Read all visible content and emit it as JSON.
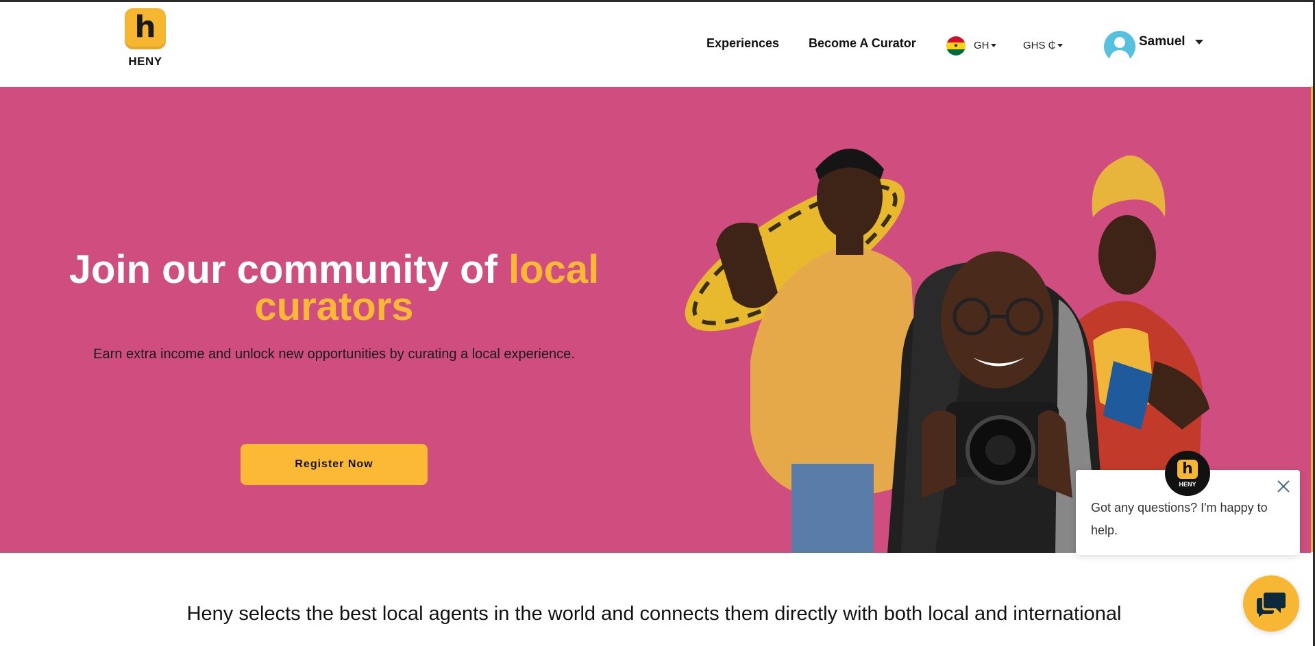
{
  "brand": {
    "name": "HENY",
    "mark": "h"
  },
  "nav": {
    "experiences": "Experiences",
    "become_curator": "Become A Curator"
  },
  "locale": {
    "country_code": "GH",
    "currency": "GHS ₵"
  },
  "user": {
    "name": "Samuel"
  },
  "hero": {
    "title_part1": "Join our community of ",
    "title_highlight1": "local",
    "title_highlight2": "curators",
    "subtitle": "Earn extra income and unlock new opportunities by curating a local experience.",
    "cta": "Register Now"
  },
  "chat": {
    "brand": "HENY",
    "mark": "h",
    "message": "Got any questions? I'm happy to help."
  },
  "footer_intro": {
    "text": "Heny selects the best local agents in the world and connects them directly with both local and international"
  },
  "colors": {
    "hero_bg": "#cf4e7f",
    "accent": "#fbb935",
    "avatar": "#56c1de"
  }
}
